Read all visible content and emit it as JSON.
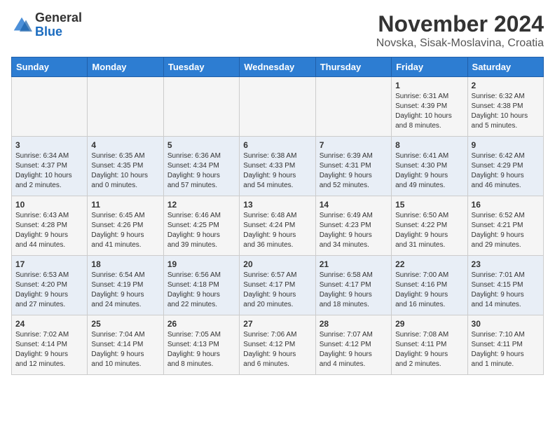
{
  "header": {
    "logo_general": "General",
    "logo_blue": "Blue",
    "month_title": "November 2024",
    "location": "Novska, Sisak-Moslavina, Croatia"
  },
  "calendar": {
    "days_of_week": [
      "Sunday",
      "Monday",
      "Tuesday",
      "Wednesday",
      "Thursday",
      "Friday",
      "Saturday"
    ],
    "weeks": [
      [
        {
          "day": "",
          "info": ""
        },
        {
          "day": "",
          "info": ""
        },
        {
          "day": "",
          "info": ""
        },
        {
          "day": "",
          "info": ""
        },
        {
          "day": "",
          "info": ""
        },
        {
          "day": "1",
          "info": "Sunrise: 6:31 AM\nSunset: 4:39 PM\nDaylight: 10 hours\nand 8 minutes."
        },
        {
          "day": "2",
          "info": "Sunrise: 6:32 AM\nSunset: 4:38 PM\nDaylight: 10 hours\nand 5 minutes."
        }
      ],
      [
        {
          "day": "3",
          "info": "Sunrise: 6:34 AM\nSunset: 4:37 PM\nDaylight: 10 hours\nand 2 minutes."
        },
        {
          "day": "4",
          "info": "Sunrise: 6:35 AM\nSunset: 4:35 PM\nDaylight: 10 hours\nand 0 minutes."
        },
        {
          "day": "5",
          "info": "Sunrise: 6:36 AM\nSunset: 4:34 PM\nDaylight: 9 hours\nand 57 minutes."
        },
        {
          "day": "6",
          "info": "Sunrise: 6:38 AM\nSunset: 4:33 PM\nDaylight: 9 hours\nand 54 minutes."
        },
        {
          "day": "7",
          "info": "Sunrise: 6:39 AM\nSunset: 4:31 PM\nDaylight: 9 hours\nand 52 minutes."
        },
        {
          "day": "8",
          "info": "Sunrise: 6:41 AM\nSunset: 4:30 PM\nDaylight: 9 hours\nand 49 minutes."
        },
        {
          "day": "9",
          "info": "Sunrise: 6:42 AM\nSunset: 4:29 PM\nDaylight: 9 hours\nand 46 minutes."
        }
      ],
      [
        {
          "day": "10",
          "info": "Sunrise: 6:43 AM\nSunset: 4:28 PM\nDaylight: 9 hours\nand 44 minutes."
        },
        {
          "day": "11",
          "info": "Sunrise: 6:45 AM\nSunset: 4:26 PM\nDaylight: 9 hours\nand 41 minutes."
        },
        {
          "day": "12",
          "info": "Sunrise: 6:46 AM\nSunset: 4:25 PM\nDaylight: 9 hours\nand 39 minutes."
        },
        {
          "day": "13",
          "info": "Sunrise: 6:48 AM\nSunset: 4:24 PM\nDaylight: 9 hours\nand 36 minutes."
        },
        {
          "day": "14",
          "info": "Sunrise: 6:49 AM\nSunset: 4:23 PM\nDaylight: 9 hours\nand 34 minutes."
        },
        {
          "day": "15",
          "info": "Sunrise: 6:50 AM\nSunset: 4:22 PM\nDaylight: 9 hours\nand 31 minutes."
        },
        {
          "day": "16",
          "info": "Sunrise: 6:52 AM\nSunset: 4:21 PM\nDaylight: 9 hours\nand 29 minutes."
        }
      ],
      [
        {
          "day": "17",
          "info": "Sunrise: 6:53 AM\nSunset: 4:20 PM\nDaylight: 9 hours\nand 27 minutes."
        },
        {
          "day": "18",
          "info": "Sunrise: 6:54 AM\nSunset: 4:19 PM\nDaylight: 9 hours\nand 24 minutes."
        },
        {
          "day": "19",
          "info": "Sunrise: 6:56 AM\nSunset: 4:18 PM\nDaylight: 9 hours\nand 22 minutes."
        },
        {
          "day": "20",
          "info": "Sunrise: 6:57 AM\nSunset: 4:17 PM\nDaylight: 9 hours\nand 20 minutes."
        },
        {
          "day": "21",
          "info": "Sunrise: 6:58 AM\nSunset: 4:17 PM\nDaylight: 9 hours\nand 18 minutes."
        },
        {
          "day": "22",
          "info": "Sunrise: 7:00 AM\nSunset: 4:16 PM\nDaylight: 9 hours\nand 16 minutes."
        },
        {
          "day": "23",
          "info": "Sunrise: 7:01 AM\nSunset: 4:15 PM\nDaylight: 9 hours\nand 14 minutes."
        }
      ],
      [
        {
          "day": "24",
          "info": "Sunrise: 7:02 AM\nSunset: 4:14 PM\nDaylight: 9 hours\nand 12 minutes."
        },
        {
          "day": "25",
          "info": "Sunrise: 7:04 AM\nSunset: 4:14 PM\nDaylight: 9 hours\nand 10 minutes."
        },
        {
          "day": "26",
          "info": "Sunrise: 7:05 AM\nSunset: 4:13 PM\nDaylight: 9 hours\nand 8 minutes."
        },
        {
          "day": "27",
          "info": "Sunrise: 7:06 AM\nSunset: 4:12 PM\nDaylight: 9 hours\nand 6 minutes."
        },
        {
          "day": "28",
          "info": "Sunrise: 7:07 AM\nSunset: 4:12 PM\nDaylight: 9 hours\nand 4 minutes."
        },
        {
          "day": "29",
          "info": "Sunrise: 7:08 AM\nSunset: 4:11 PM\nDaylight: 9 hours\nand 2 minutes."
        },
        {
          "day": "30",
          "info": "Sunrise: 7:10 AM\nSunset: 4:11 PM\nDaylight: 9 hours\nand 1 minute."
        }
      ]
    ]
  }
}
